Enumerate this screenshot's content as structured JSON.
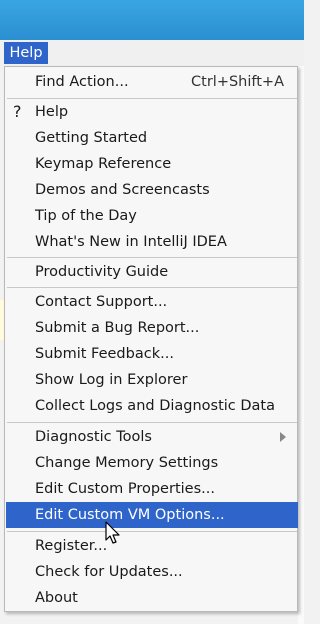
{
  "menubar": {
    "help_label": "Help"
  },
  "menu": {
    "find_action": {
      "label": "Find Action...",
      "shortcut": "Ctrl+Shift+A"
    },
    "help": {
      "label": "Help",
      "icon": "?"
    },
    "getting_started": "Getting Started",
    "keymap_reference": "Keymap Reference",
    "demos": "Demos and Screencasts",
    "tip_of_day": "Tip of the Day",
    "whats_new": "What's New in IntelliJ IDEA",
    "productivity_guide": "Productivity Guide",
    "contact_support": "Contact Support...",
    "submit_bug": "Submit a Bug Report...",
    "submit_feedback": "Submit Feedback...",
    "show_log": "Show Log in Explorer",
    "collect_logs": "Collect Logs and Diagnostic Data",
    "diagnostic_tools": "Diagnostic Tools",
    "change_memory": "Change Memory Settings",
    "edit_properties": "Edit Custom Properties...",
    "edit_vm_options": "Edit Custom VM Options...",
    "register": "Register...",
    "check_updates": "Check for Updates...",
    "about": "About"
  },
  "colors": {
    "selection": "#2f65ca",
    "titlebar": "#2b8fd0"
  }
}
